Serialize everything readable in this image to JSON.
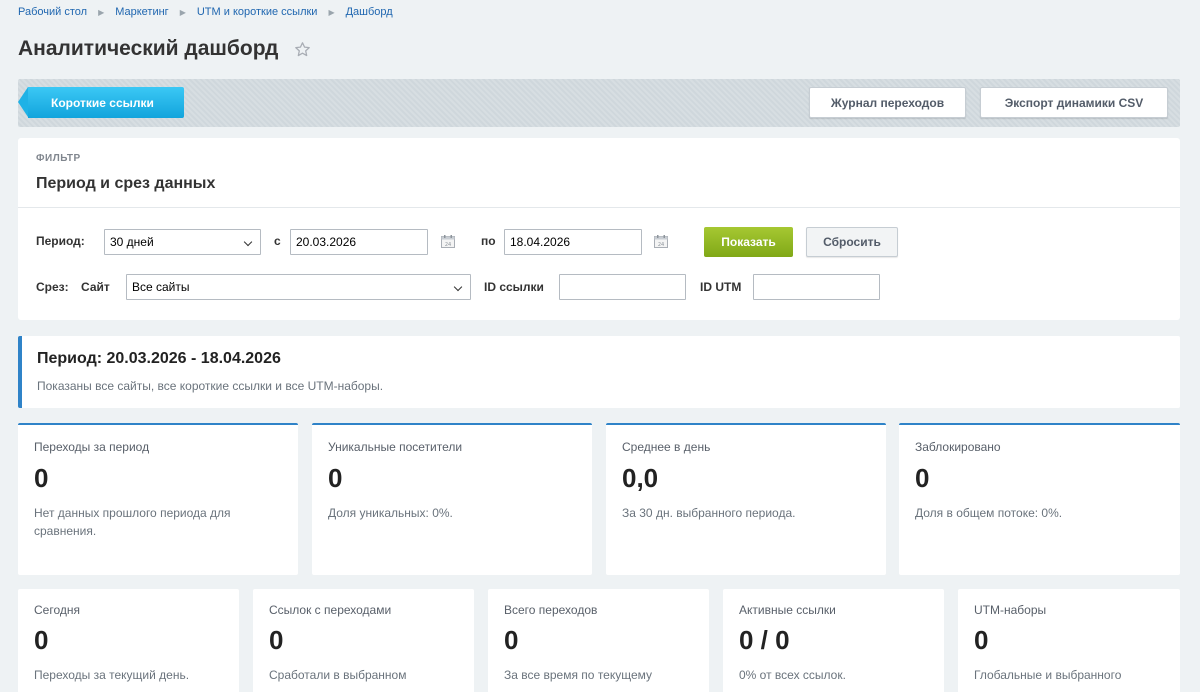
{
  "breadcrumb": [
    "Рабочий стол",
    "Маркетинг",
    "UTM и короткие ссылки",
    "Дашборд"
  ],
  "page": {
    "title": "Аналитический дашборд"
  },
  "toolbar": {
    "back_label": "Короткие ссылки",
    "log_label": "Журнал переходов",
    "export_label": "Экспорт динамики CSV"
  },
  "filter": {
    "eyebrow": "ФИЛЬТР",
    "heading": "Период и срез данных",
    "period_label": "Период:",
    "period_value": "30 дней",
    "from_label": "с",
    "from_value": "20.03.2026",
    "to_label": "по",
    "to_value": "18.04.2026",
    "show_label": "Показать",
    "reset_label": "Сбросить",
    "slice_label": "Срез:",
    "site_label": "Сайт",
    "site_value": "Все сайты",
    "link_id_label": "ID ссылки",
    "link_id_value": "",
    "utm_id_label": "ID UTM",
    "utm_id_value": ""
  },
  "period_summary": {
    "title": "Период: 20.03.2026 - 18.04.2026",
    "description": "Показаны все сайты, все короткие ссылки и все UTM-наборы."
  },
  "stats_row1": [
    {
      "label": "Переходы за период",
      "value": "0",
      "note": "Нет данных прошлого периода для сравнения."
    },
    {
      "label": "Уникальные посетители",
      "value": "0",
      "note": "Доля уникальных: 0%."
    },
    {
      "label": "Среднее в день",
      "value": "0,0",
      "note": "За 30 дн. выбранного периода."
    },
    {
      "label": "Заблокировано",
      "value": "0",
      "note": "Доля в общем потоке: 0%."
    }
  ],
  "stats_row2": [
    {
      "label": "Сегодня",
      "value": "0",
      "note": "Переходы за текущий день."
    },
    {
      "label": "Ссылок с переходами",
      "value": "0",
      "note": "Сработали в выбранном"
    },
    {
      "label": "Всего переходов",
      "value": "0",
      "note": "За все время по текущему"
    },
    {
      "label": "Активные ссылки",
      "value": "0 / 0",
      "note": "0% от всех ссылок."
    },
    {
      "label": "UTM-наборы",
      "value": "0",
      "note": "Глобальные и выбранного"
    }
  ],
  "colors": {
    "accent": "#2f83c8",
    "primary_button": "#80a817",
    "back_button": "#12a4dc"
  }
}
